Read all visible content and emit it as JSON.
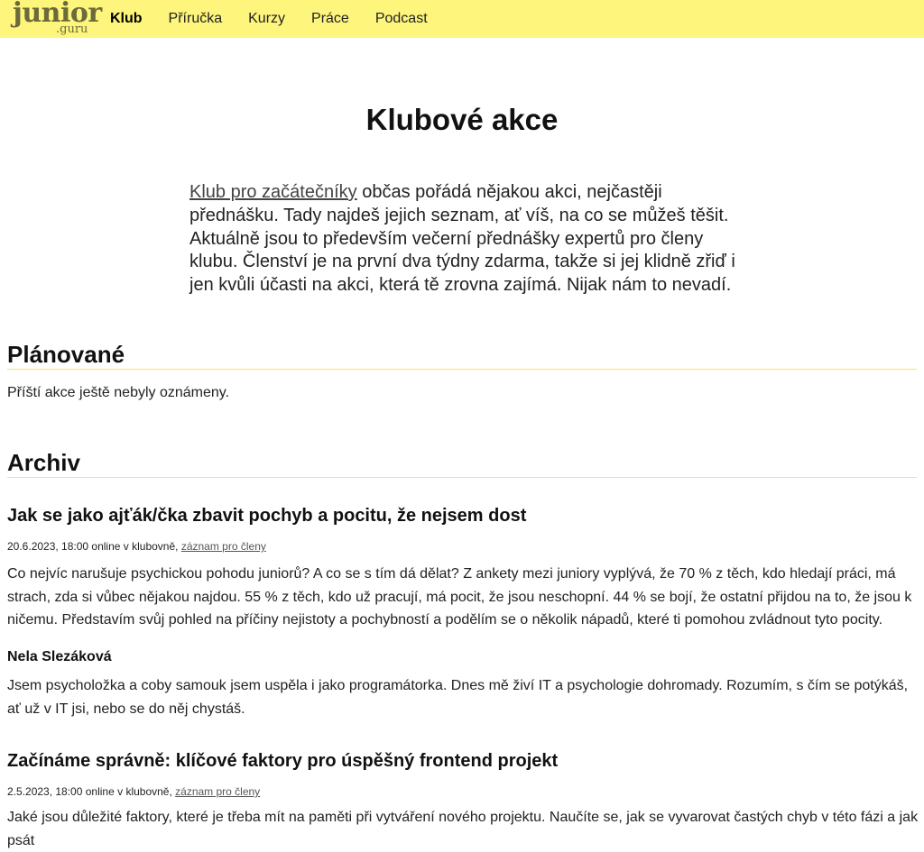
{
  "nav": {
    "logo_main": "junior",
    "logo_sub": ".guru",
    "items": [
      {
        "label": "Klub",
        "active": true
      },
      {
        "label": "Příručka"
      },
      {
        "label": "Kurzy"
      },
      {
        "label": "Práce"
      },
      {
        "label": "Podcast"
      }
    ]
  },
  "page": {
    "title": "Klubové akce",
    "intro_link": "Klub pro začátečníky",
    "intro_text": " občas pořádá nějakou akci, nejčastěji přednášku. Tady najdeš jejich seznam, ať víš, na co se můžeš těšit. Aktuálně jsou to především večerní přednášky expertů pro členy klubu. Členství je na první dva týdny zdarma, takže si jej klidně zřiď i jen kvůli účasti na akci, která tě zrovna zajímá. Nijak nám to nevadí."
  },
  "planned": {
    "heading": "Plánované",
    "empty_text": "Příští akce ještě nebyly oznámeny."
  },
  "archive": {
    "heading": "Archiv",
    "events": [
      {
        "title": "Jak se jako ajťák/čka zbavit pochyb a pocitu, že nejsem dost",
        "meta": "20.6.2023, 18:00 online v klubovně, ",
        "recording_link": "záznam pro členy",
        "description": "Co nejvíc narušuje psychickou pohodu juniorů? A co se s tím dá dělat? Z ankety mezi juniory vyplývá, že 70 % z těch, kdo hledají práci, má strach, zda si vůbec nějakou najdou. 55 % z těch, kdo už pracují, má pocit, že jsou neschopní. 44 % se bojí, že ostatní přijdou na to, že jsou k ničemu. Představím svůj pohled na příčiny nejistoty a pochybností a podělím se o několik nápadů, které ti pomohou zvládnout tyto pocity.",
        "speaker": "Nela Slezáková",
        "speaker_bio": "Jsem psycholožka a coby samouk jsem uspěla i jako programátorka. Dnes mě živí IT a psychologie dohromady. Rozumím, s čím se potýkáš, ať už v IT jsi, nebo se do něj chystáš."
      },
      {
        "title": "Začínáme správně: klíčové faktory pro úspěšný frontend projekt",
        "meta": "2.5.2023, 18:00 online v klubovně, ",
        "recording_link": "záznam pro členy",
        "description": "Jaké jsou důležité faktory, které je třeba mít na paměti při vytváření nového projektu. Naučíte se, jak se vyvarovat častých chyb v této fázi a jak psát"
      }
    ]
  }
}
